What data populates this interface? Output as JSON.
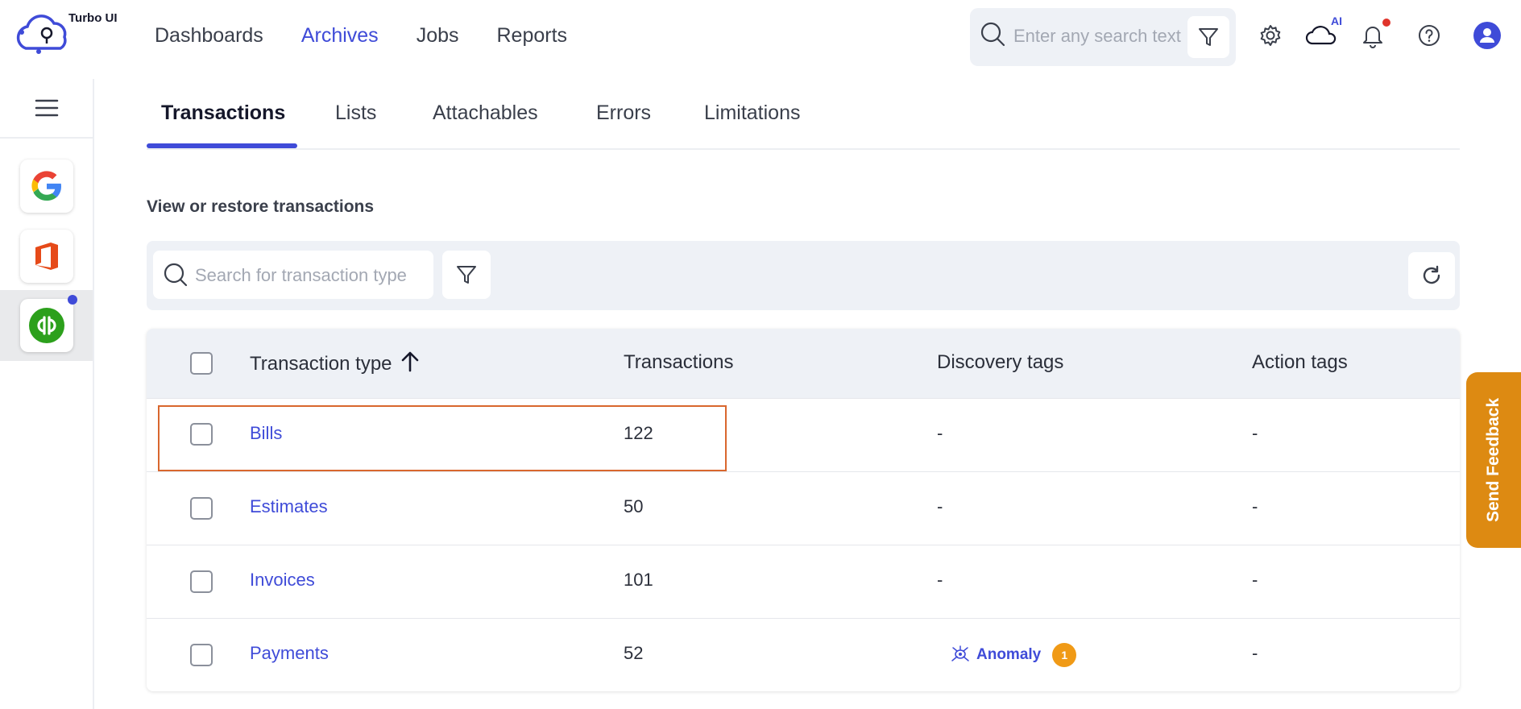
{
  "app": {
    "brand": "Turbo UI"
  },
  "nav": {
    "items": [
      {
        "label": "Dashboards",
        "active": false
      },
      {
        "label": "Archives",
        "active": true
      },
      {
        "label": "Jobs",
        "active": false
      },
      {
        "label": "Reports",
        "active": false
      }
    ]
  },
  "header": {
    "search_placeholder": "Enter any search text",
    "ai_badge": "AI",
    "icons": [
      "search-icon",
      "filter-icon",
      "gear-icon",
      "cloud-ai-icon",
      "bell-icon",
      "help-icon",
      "user-avatar-icon"
    ]
  },
  "rail": {
    "apps": [
      "google-icon",
      "office-icon",
      "quickbooks-icon"
    ],
    "active_app": "quickbooks-icon"
  },
  "tabs": [
    {
      "label": "Transactions",
      "active": true
    },
    {
      "label": "Lists",
      "active": false
    },
    {
      "label": "Attachables",
      "active": false
    },
    {
      "label": "Errors",
      "active": false
    },
    {
      "label": "Limitations",
      "active": false
    }
  ],
  "section_title": "View or restore transactions",
  "toolbar": {
    "search_placeholder": "Search for transaction type"
  },
  "table": {
    "columns": [
      "Transaction type",
      "Transactions",
      "Discovery tags",
      "Action tags"
    ],
    "sort": {
      "column": "Transaction type",
      "direction": "ascending"
    },
    "rows": [
      {
        "type": "Bills",
        "count": "122",
        "discovery": "-",
        "action": "-"
      },
      {
        "type": "Estimates",
        "count": "50",
        "discovery": "-",
        "action": "-"
      },
      {
        "type": "Invoices",
        "count": "101",
        "discovery": "-",
        "action": "-"
      },
      {
        "type": "Payments",
        "count": "52",
        "discovery_tag": {
          "label": "Anomaly",
          "count": "1"
        },
        "action": "-"
      }
    ]
  },
  "feedback": {
    "label": "Send Feedback"
  },
  "colors": {
    "accent": "#3f4bd8",
    "feedback": "#dd8a12",
    "badge": "#f09a16",
    "highlight": "#d9672e"
  }
}
